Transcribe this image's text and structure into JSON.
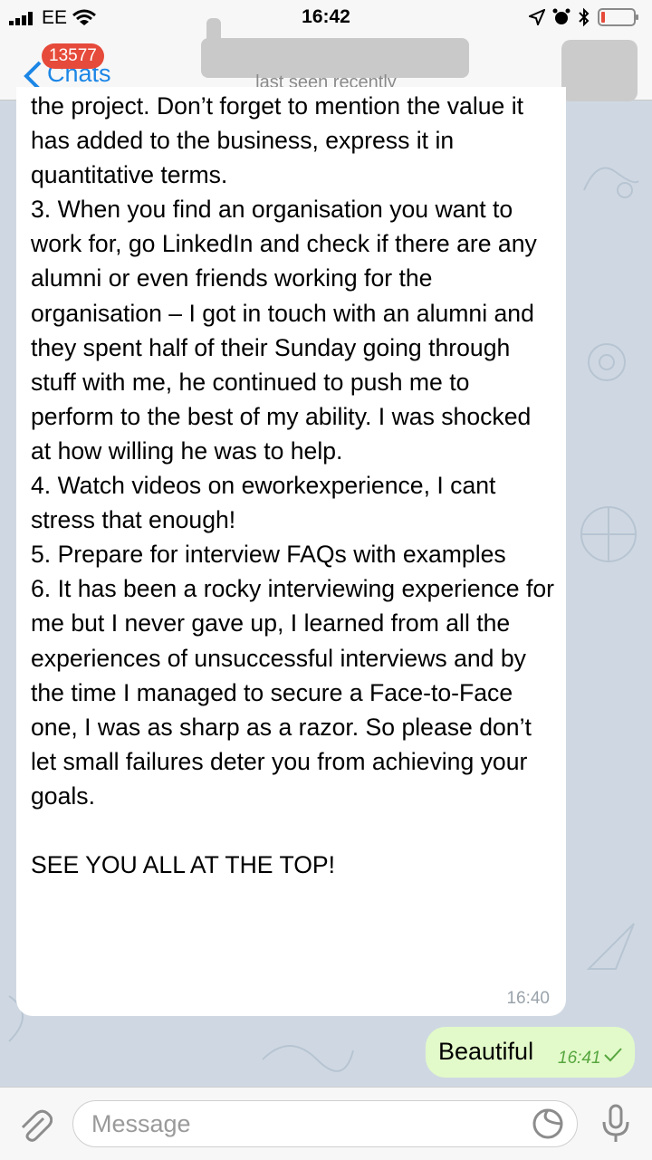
{
  "status_bar": {
    "carrier": "EE",
    "time": "16:42"
  },
  "nav": {
    "back_label": "Chats",
    "unread_count": "13577",
    "subtitle": "last seen recently"
  },
  "incoming_message": {
    "paragraphs": [
      "the project. Don’t forget to mention the value it has added to the business, express it in quantitative terms.",
      "3.  When you find an organisation you want to work for, go LinkedIn and check if there are any alumni or even friends working for the organisation – I got in touch with an alumni and they spent half of their Sunday going through stuff with me, he continued to push me to perform to the best of my ability. I was shocked at how willing he was to help.",
      "4.  Watch videos on eworkexperience, I cant stress that enough!",
      "5.  Prepare for interview FAQs with examples",
      "6.  It has been a rocky interviewing experience for me but I never gave up, I learned from all the experiences of unsuccessful interviews and by the time I managed to secure a Face-to-Face one, I was as sharp as a razor. So please don’t let small failures deter you from achieving your goals.",
      "",
      "SEE YOU ALL AT THE TOP!"
    ],
    "time": "16:40"
  },
  "outgoing_message": {
    "text": "Beautiful",
    "time": "16:41",
    "status": "read"
  },
  "composer": {
    "placeholder": "Message"
  },
  "icons": {
    "signal": "signal-icon",
    "wifi": "wifi-icon",
    "location": "location-arrow-icon",
    "alarm": "alarm-icon",
    "bluetooth": "bluetooth-icon",
    "battery": "battery-icon",
    "attach": "paperclip-icon",
    "sticker": "sticker-icon",
    "mic": "microphone-icon"
  },
  "colors": {
    "accent": "#1b86e6",
    "badge": "#e64a3a",
    "outgoing_bubble": "#e2fac9",
    "outgoing_time": "#57a63f",
    "battery_low": "#e64a3a"
  }
}
